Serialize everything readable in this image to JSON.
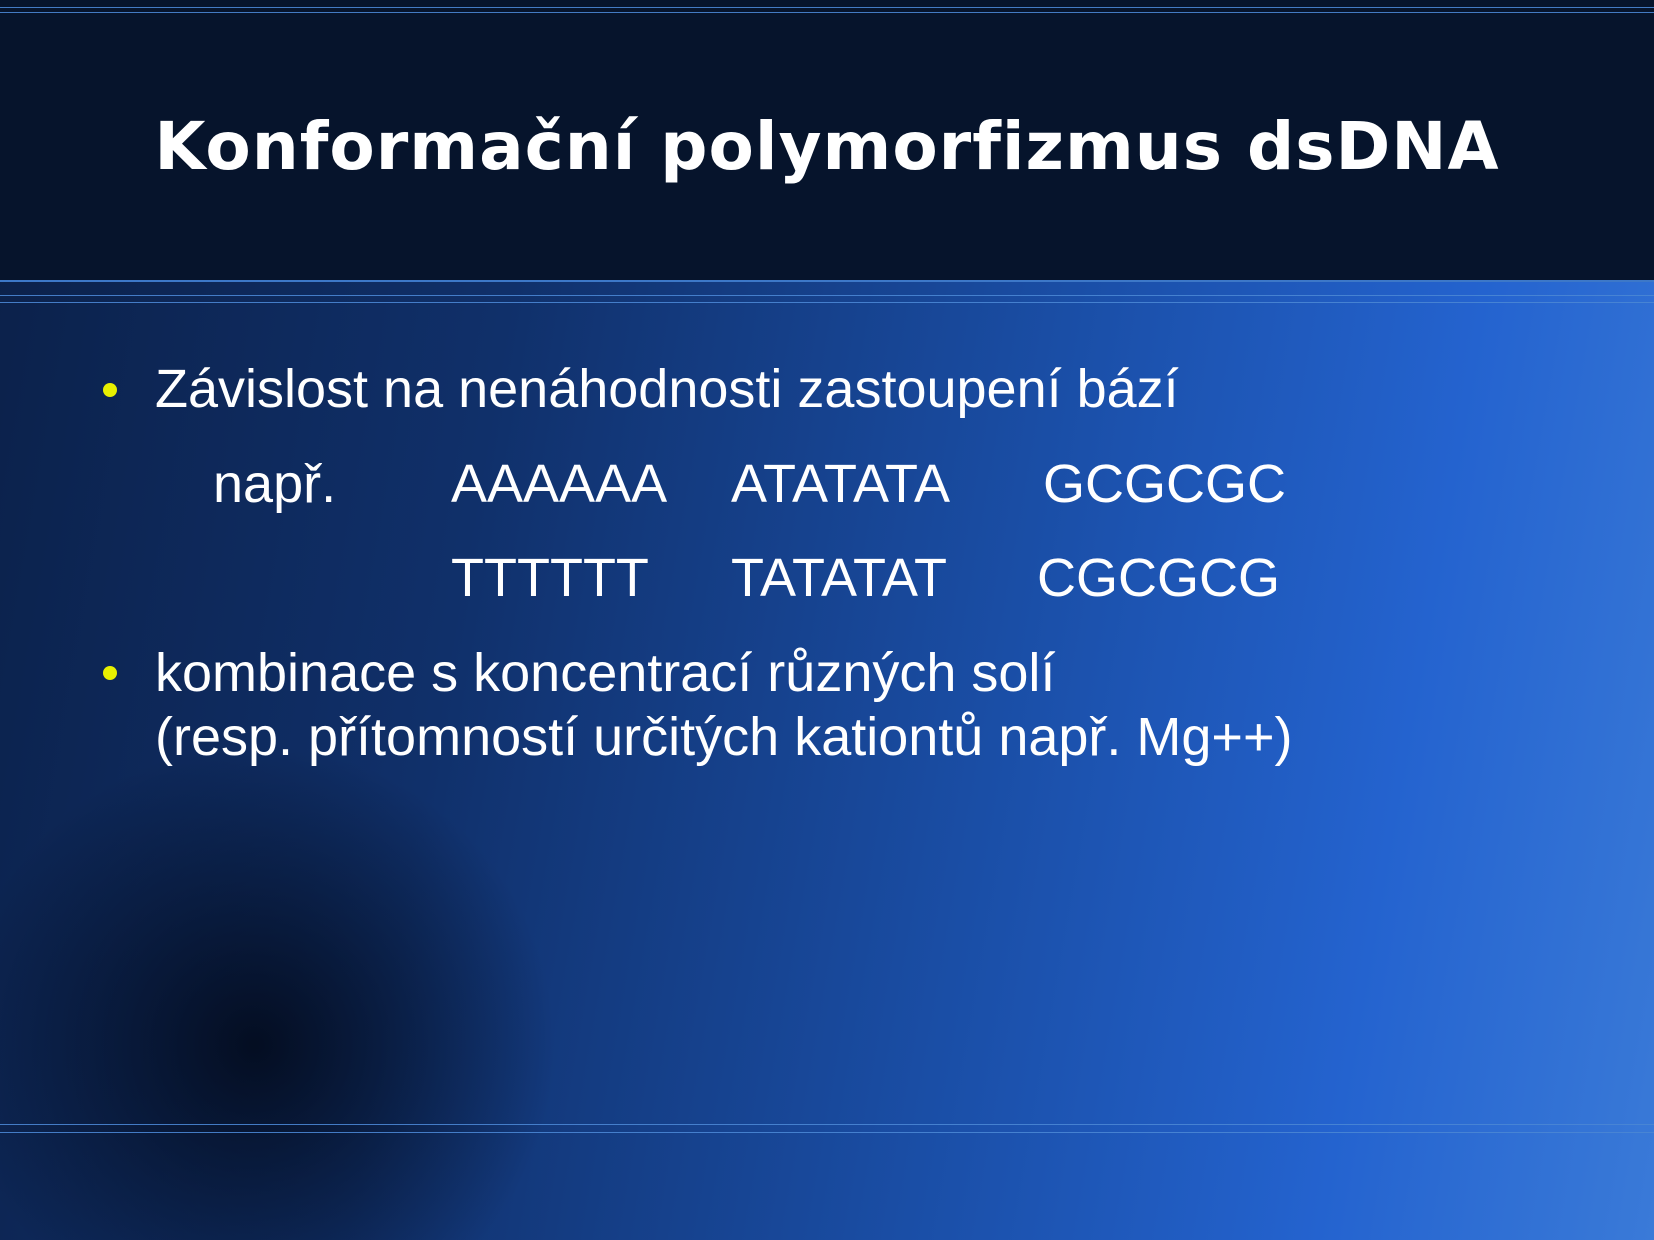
{
  "slide": {
    "title": "Konformační polymorfizmus dsDNA",
    "bullet1": {
      "text": "Závislost na nenáhodnosti zastoupení bází",
      "example_label": "např.",
      "row1": [
        "AAAAAA",
        "ATATATA",
        "GCGCGC"
      ],
      "row2": [
        "TTTTTT",
        "TATATAT",
        "CGCGCG"
      ]
    },
    "bullet2": {
      "line1": "kombinace s koncentrací různých solí",
      "line2": "(resp. přítomností určitých kationtů např. Mg++)"
    },
    "colors": {
      "title_band": "#06142c",
      "bullet": "#e8f000",
      "text": "#ffffff",
      "rule": "#3d78c8"
    }
  }
}
